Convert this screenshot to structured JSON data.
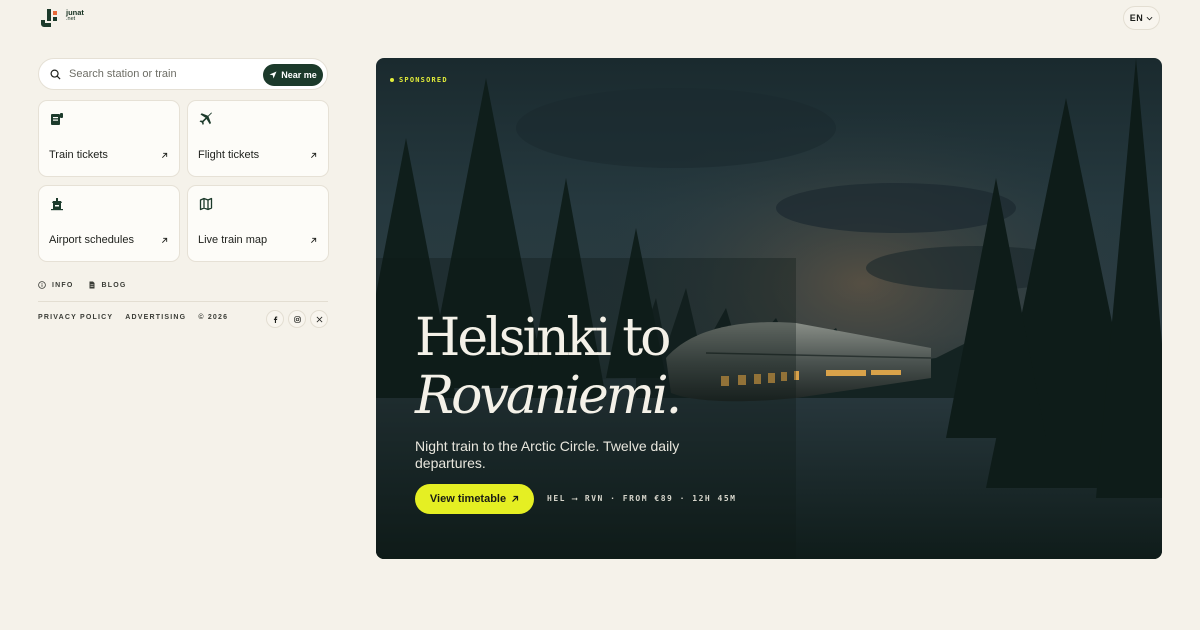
{
  "brand": {
    "name": "junat",
    "tld": ".net"
  },
  "header": {
    "language": "EN"
  },
  "search": {
    "placeholder": "Search station or train",
    "value": "",
    "near_me_label": "Near me"
  },
  "cards": [
    {
      "label": "Train tickets",
      "icon": "train-ticket-icon"
    },
    {
      "label": "Flight tickets",
      "icon": "airplane-icon"
    },
    {
      "label": "Airport schedules",
      "icon": "airport-icon"
    },
    {
      "label": "Live train map",
      "icon": "map-icon"
    }
  ],
  "links": {
    "info": "INFO",
    "blog": "BLOG"
  },
  "legal": {
    "privacy": "PRIVACY POLICY",
    "advertising": "ADVERTISING",
    "copyright": "© 2026"
  },
  "socials": [
    "facebook-icon",
    "instagram-icon",
    "x-icon"
  ],
  "hero": {
    "badge": "SPONSORED",
    "title_line1": "Helsinki to",
    "title_line2": "Rovaniemi.",
    "subtitle": "Night train to the Arctic Circle. Twelve daily departures.",
    "cta_label": "View timetable",
    "route_info": "HEL ⟶ RVN · FROM €89 · 12H 45M"
  },
  "colors": {
    "accent": "#e5ef23",
    "brand_dark": "#1c3a2b",
    "background": "#f5f2ea"
  }
}
